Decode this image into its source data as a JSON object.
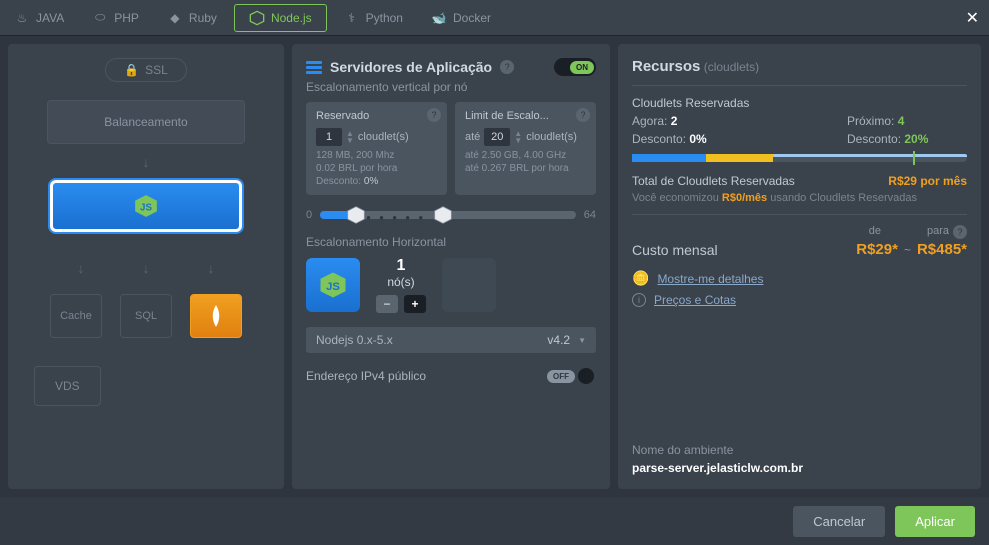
{
  "tabs": {
    "java": "JAVA",
    "php": "PHP",
    "ruby": "Ruby",
    "node": "Node.js",
    "python": "Python",
    "docker": "Docker"
  },
  "leftCol": {
    "ssl": "SSL",
    "balance": "Balanceamento",
    "cache": "Cache",
    "sql": "SQL",
    "vds": "VDS"
  },
  "appServers": {
    "title": "Servidores de Aplicação",
    "toggle": "ON",
    "verticalScaling": "Escalonamento vertical por nó",
    "reserved": {
      "title": "Reservado",
      "value": "1",
      "unit": "cloudlet(s)",
      "spec": "128 MB, 200 Mhz",
      "price": "0.02 BRL por hora",
      "discountLabel": "Desconto:",
      "discount": "0%"
    },
    "limit": {
      "title": "Limit de Escalo...",
      "prefix": "até",
      "value": "20",
      "unit": "cloudlet(s)",
      "spec": "até 2.50 GB, 4.00 GHz",
      "price": "até 0.267 BRL por hora"
    },
    "slider": {
      "min": "0",
      "max": "64"
    },
    "horizScaling": "Escalonamento Horizontal",
    "nodes": {
      "count": "1",
      "unit": "nó(s)"
    },
    "runtime": {
      "name": "Nodejs 0.x-5.x",
      "version": "v4.2"
    },
    "ipv4": {
      "label": "Endereço IPv4 público",
      "toggle": "OFF"
    }
  },
  "resources": {
    "title": "Recursos",
    "subtitle": "(cloudlets)",
    "reservedCloudlets": "Cloudlets Reservadas",
    "now": {
      "label": "Agora:",
      "value": "2"
    },
    "next": {
      "label": "Próximo:",
      "value": "4"
    },
    "discNow": {
      "label": "Desconto:",
      "value": "0%"
    },
    "discNext": {
      "label": "Desconto:",
      "value": "20%"
    },
    "totalReserved": {
      "label": "Total de Cloudlets Reservadas",
      "value": "R$29 por mês"
    },
    "savings": {
      "prefix": "Você economizou ",
      "amount": "R$0/mês",
      "suffix": " usando Cloudlets Reservadas"
    },
    "monthlyCost": "Custo mensal",
    "from": {
      "label": "de",
      "value": "R$29*"
    },
    "to": {
      "label": "para",
      "value": "R$485*"
    },
    "showDetails": "Mostre-me detalhes",
    "prices": "Preços e Cotas",
    "envLabel": "Nome do ambiente",
    "envValue": "parse-server.jelasticlw.com.br"
  },
  "footer": {
    "cancel": "Cancelar",
    "apply": "Aplicar"
  }
}
